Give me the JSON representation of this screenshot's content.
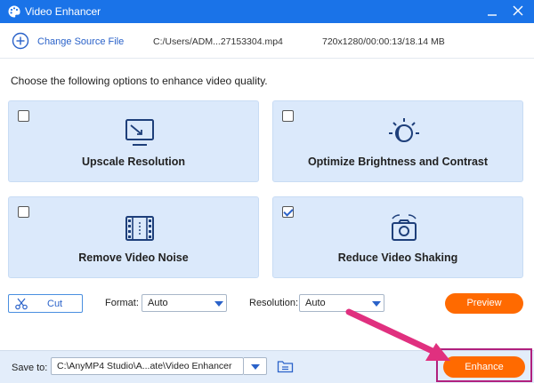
{
  "window": {
    "title": "Video Enhancer"
  },
  "source": {
    "change_label": "Change Source File",
    "path": "C:/Users/ADM...27153304.mp4",
    "meta": "720x1280/00:00:13/18.14 MB"
  },
  "instruction": "Choose the following options to enhance video quality.",
  "options": [
    {
      "label": "Upscale Resolution",
      "checked": false,
      "icon": "monitor-icon"
    },
    {
      "label": "Optimize Brightness and Contrast",
      "checked": false,
      "icon": "brightness-icon"
    },
    {
      "label": "Remove Video Noise",
      "checked": false,
      "icon": "film-icon"
    },
    {
      "label": "Reduce Video Shaking",
      "checked": true,
      "icon": "camera-shake-icon"
    }
  ],
  "toolbar": {
    "cut_label": "Cut",
    "format_label": "Format:",
    "format_value": "Auto",
    "resolution_label": "Resolution:",
    "resolution_value": "Auto",
    "preview_label": "Preview"
  },
  "footer": {
    "save_label": "Save to:",
    "save_path": "C:\\AnyMP4 Studio\\A...ate\\Video Enhancer",
    "enhance_label": "Enhance"
  },
  "colors": {
    "titlebar": "#1a73e8",
    "accent": "#2a62c9",
    "card_bg": "#dbe9fb",
    "button_orange": "#ff6a00",
    "highlight": "#b0207e",
    "arrow": "#e0307f"
  }
}
